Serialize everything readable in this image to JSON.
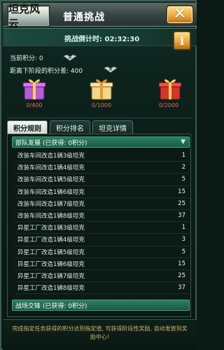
{
  "header": {
    "logo_text": "坦克风云",
    "title": "普通挑战",
    "close_label": "✕",
    "info_label": "i"
  },
  "countdown": {
    "text": "挑战倒计时: 02:32:30"
  },
  "score": {
    "current_label": "当前积分: 0",
    "next_gap_label": "距离下阶段的积分差: 400"
  },
  "rewards": [
    {
      "label": "0/400",
      "color": "#b75ad8"
    },
    {
      "label": "0/1000",
      "color": "#f1d78b"
    },
    {
      "label": "0/2000",
      "color": "#d6332b"
    }
  ],
  "tabs": [
    {
      "label": "积分规则",
      "active": true
    },
    {
      "label": "积分排名",
      "active": false
    },
    {
      "label": "坦克详情",
      "active": false
    }
  ],
  "sections": {
    "army": "部队发展 (已获得: 0积分)",
    "battle": "战场交锋 (已获得: 0积分)"
  },
  "rows": [
    {
      "name": "改装车间改造1辆3级坦克",
      "score": "1"
    },
    {
      "name": "改装车间改造1辆4级坦克",
      "score": "2"
    },
    {
      "name": "改装车间改造1辆5级坦克",
      "score": "5"
    },
    {
      "name": "改装车间改造1辆6级坦克",
      "score": "15"
    },
    {
      "name": "改装车间改造1辆7级坦克",
      "score": "25"
    },
    {
      "name": "改装车间改造1辆8级坦克",
      "score": "37"
    },
    {
      "name": "异星工厂改造1辆3级坦克",
      "score": "1"
    },
    {
      "name": "异星工厂改造1辆4级坦克",
      "score": "3"
    },
    {
      "name": "异星工厂改造1辆5级坦克",
      "score": "5"
    },
    {
      "name": "异星工厂改造1辆6级坦克",
      "score": "15"
    },
    {
      "name": "异星工厂改造1辆7级坦克",
      "score": "25"
    },
    {
      "name": "异星工厂改造1辆8级坦克",
      "score": "37"
    }
  ],
  "footer": {
    "text": "完成指定任务获得的积分达到指定值, 可获得阶段性奖励, 自动发放到奖励中心!"
  }
}
